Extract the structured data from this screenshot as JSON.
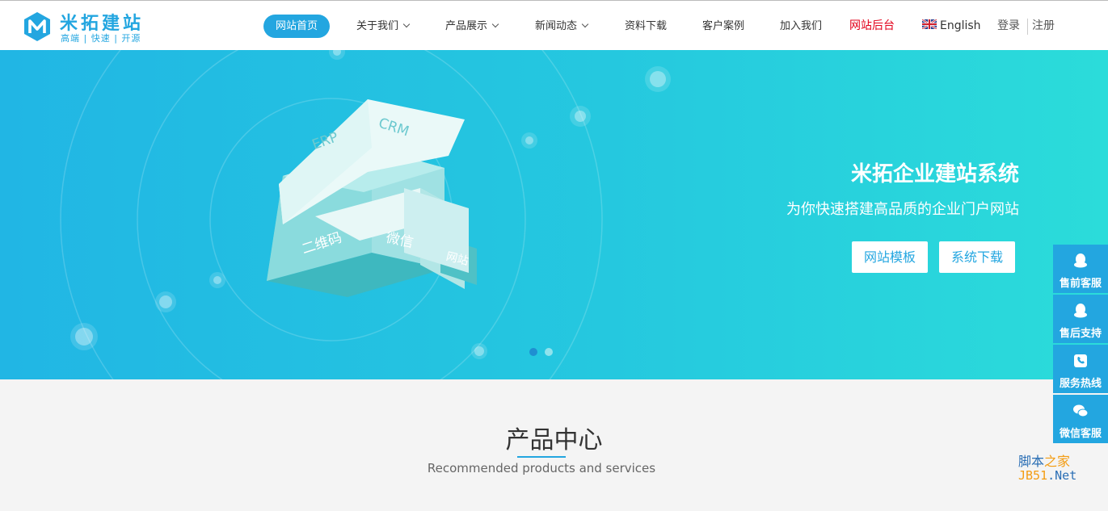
{
  "logo": {
    "title": "米拓建站",
    "slogan": "高端 | 快速 | 开源"
  },
  "nav": {
    "items": [
      {
        "label": "网站首页"
      },
      {
        "label": "关于我们"
      },
      {
        "label": "产品展示"
      },
      {
        "label": "新闻动态"
      },
      {
        "label": "资料下载"
      },
      {
        "label": "客户案例"
      },
      {
        "label": "加入我们"
      },
      {
        "label": "网站后台"
      }
    ],
    "language": "English",
    "login": "登录",
    "register": "注册"
  },
  "banner": {
    "title": "米拓企业建站系统",
    "subtitle": "为你快速搭建高品质的企业门户网站",
    "buttons": [
      "网站模板",
      "系统下载"
    ],
    "illustration_labels": [
      "ERP",
      "CRM",
      "二维码",
      "微信",
      "网站"
    ],
    "slides_total": 2,
    "slide_active": 1
  },
  "section": {
    "title": "产品中心",
    "subtitle": "Recommended products and services"
  },
  "side_service": [
    {
      "label": "售前客服",
      "icon": "qq-icon"
    },
    {
      "label": "售后支持",
      "icon": "qq-icon"
    },
    {
      "label": "服务热线",
      "icon": "phone-icon"
    },
    {
      "label": "微信客服",
      "icon": "wechat-icon"
    }
  ],
  "watermark": {
    "line1_a": "脚本",
    "line1_b": "之家",
    "line2_a": "JB51",
    "line2_b": ".Net"
  },
  "colors": {
    "accent": "#23a6e0",
    "admin_link": "#e2001a",
    "banner_start": "#21b6e4",
    "banner_end": "#2bdcda"
  }
}
